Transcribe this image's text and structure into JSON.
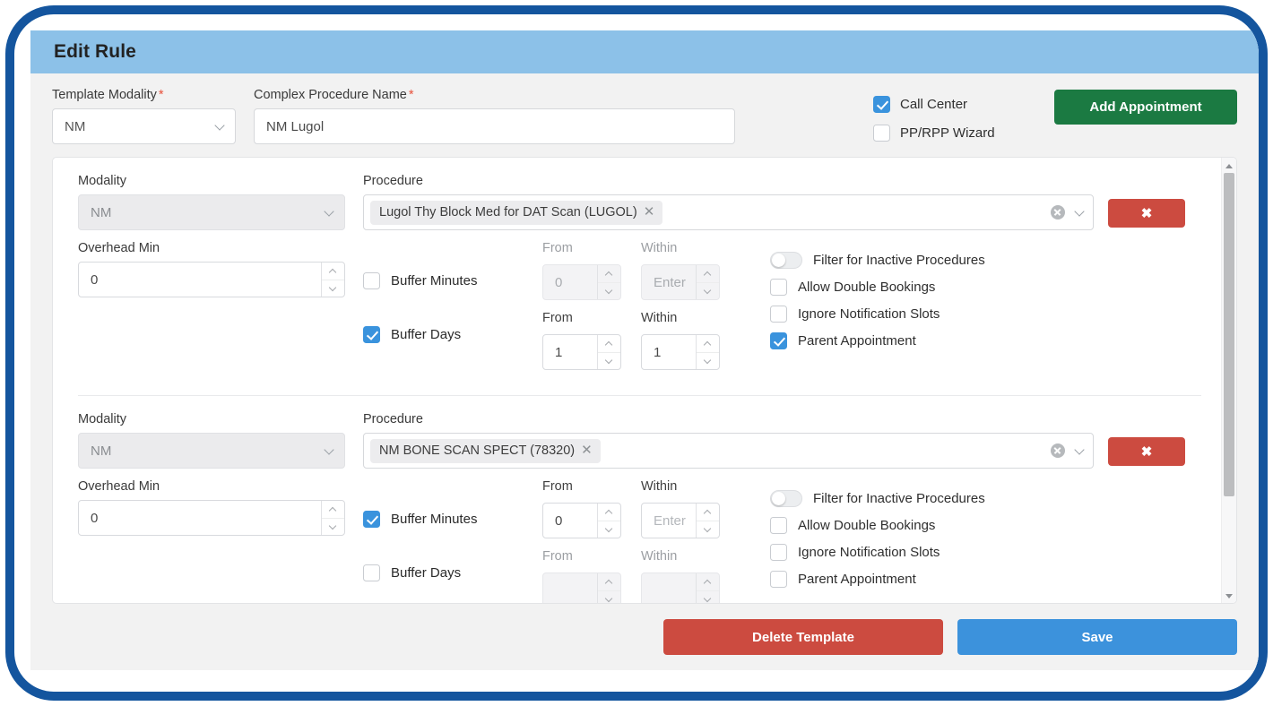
{
  "dialog": {
    "title": "Edit Rule"
  },
  "top_form": {
    "template_modality": {
      "label": "Template Modality",
      "required_mark": "*",
      "value": "NM"
    },
    "complex_procedure_name": {
      "label": "Complex Procedure Name",
      "required_mark": "*",
      "value": "NM Lugol"
    },
    "checkboxes": [
      {
        "label": "Call Center",
        "checked": true
      },
      {
        "label": "PP/RPP Wizard",
        "checked": false
      }
    ],
    "add_appointment_label": "Add Appointment"
  },
  "labels": {
    "modality": "Modality",
    "procedure": "Procedure",
    "overhead_min": "Overhead Min",
    "from": "From",
    "within": "Within",
    "buffer_minutes": "Buffer Minutes",
    "buffer_days": "Buffer Days",
    "filter_inactive": "Filter for Inactive Procedures",
    "allow_double_bookings": "Allow Double Bookings",
    "ignore_notification_slots": "Ignore Notification Slots",
    "parent_appointment": "Parent Appointment",
    "remove_button": "✖",
    "enter_placeholder": "Enter"
  },
  "rows": [
    {
      "modality": "NM",
      "procedure_tag": "Lugol Thy Block Med for DAT Scan (LUGOL)",
      "overhead_min": "0",
      "buffer_minutes": {
        "checked": false,
        "from": "0",
        "within": "Enter",
        "within_is_placeholder": true
      },
      "buffer_days": {
        "checked": true,
        "from": "1",
        "within": "1",
        "within_is_placeholder": false
      },
      "options": {
        "filter_inactive": false,
        "allow_double_bookings": false,
        "ignore_notification_slots": false,
        "parent_appointment": true
      }
    },
    {
      "modality": "NM",
      "procedure_tag": "NM BONE SCAN SPECT (78320)",
      "overhead_min": "0",
      "buffer_minutes": {
        "checked": true,
        "from": "0",
        "within": "Enter",
        "within_is_placeholder": true
      },
      "buffer_days": {
        "checked": false,
        "from": "",
        "within": "",
        "within_is_placeholder": true
      },
      "options": {
        "filter_inactive": false,
        "allow_double_bookings": false,
        "ignore_notification_slots": false,
        "parent_appointment": false
      }
    }
  ],
  "footer": {
    "delete_label": "Delete Template",
    "save_label": "Save"
  },
  "colors": {
    "frame_blue": "#14559E",
    "header_blue": "#8CC1E8",
    "green": "#1B7A42",
    "red": "#CC4B40",
    "save_blue": "#3C92DC",
    "checkbox_blue": "#3A93DD"
  }
}
